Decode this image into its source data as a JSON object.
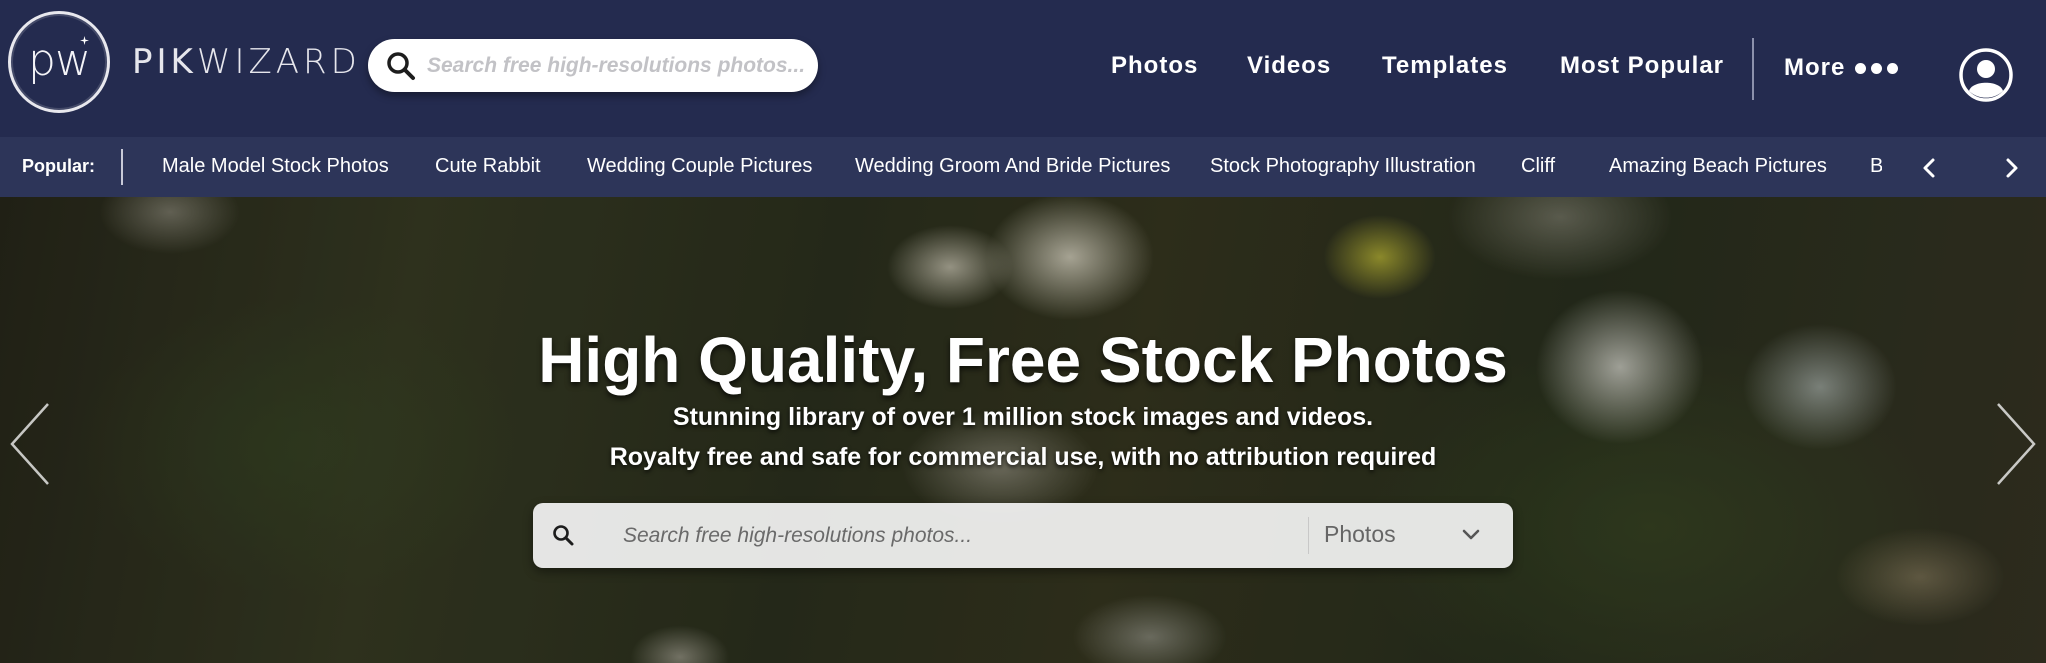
{
  "header": {
    "logo_mark": "pw",
    "logo_word_bold": "PIK",
    "logo_word_light": "WIZARD",
    "search_placeholder": "Search free high-resolutions photos...",
    "nav": [
      "Photos",
      "Videos",
      "Templates",
      "Most Popular"
    ],
    "more_label": "More"
  },
  "popular": {
    "label": "Popular:",
    "links": [
      "Male Model Stock Photos",
      "Cute Rabbit",
      "Wedding Couple Pictures",
      "Wedding Groom And Bride Pictures",
      "Stock Photography Illustration",
      "Cliff",
      "Amazing Beach Pictures",
      "Be"
    ]
  },
  "hero": {
    "title": "High Quality, Free Stock Photos",
    "subtitle_line1": "Stunning library of over 1 million stock images and videos.",
    "subtitle_line2": "Royalty free and safe for commercial use, with no attribution required",
    "search_placeholder": "Search free high-resolutions photos...",
    "search_type": "Photos"
  },
  "icons": {
    "search": "search-icon",
    "chevron_down": "chevron-down-icon",
    "chevron_left": "chevron-left-icon",
    "chevron_right": "chevron-right-icon",
    "user": "user-icon"
  },
  "colors": {
    "header_bg": "#242b4f",
    "popular_bar_bg": "#2d3559",
    "text": "#ffffff"
  }
}
